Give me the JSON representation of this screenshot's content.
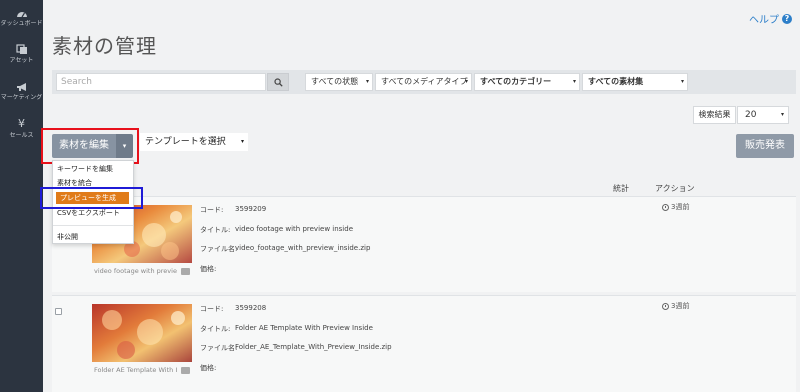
{
  "sidebar": {
    "items": [
      {
        "label": "ダッシュボード",
        "icon": "dashboard-icon"
      },
      {
        "label": "アセット",
        "icon": "assets-icon"
      },
      {
        "label": "マーケティング",
        "icon": "megaphone-icon"
      },
      {
        "label": "セールス",
        "icon": "yen-icon"
      }
    ],
    "yen_glyph": "¥"
  },
  "header": {
    "help_label": "ヘルプ",
    "help_glyph": "?",
    "title": "素材の管理"
  },
  "filters": {
    "search_placeholder": "Search",
    "status": "すべての状態",
    "media_type": "すべてのメディアタイプ",
    "category": "すべてのカテゴリー",
    "asset_set": "すべての素材集",
    "caret": "▾"
  },
  "results": {
    "label": "検索結果",
    "value": "20"
  },
  "toolbar": {
    "edit_label": "素材を編集",
    "template_label": "テンプレートを選択",
    "publish_label": "販売発表"
  },
  "dropdown": {
    "items": [
      "キーワードを編集",
      "素材を統合",
      "プレビューを生成",
      "CSVをエクスポート",
      "非公開"
    ],
    "active_index": 2
  },
  "columns": {
    "stats": "統計",
    "action": "アクション"
  },
  "rows": [
    {
      "caption": "video footage with previe",
      "code_label": "コード:",
      "code": "3599209",
      "title_label": "タイトル:",
      "title": "video footage with preview inside",
      "file_label": "ファイル名:",
      "file": "video_footage_with_preview_inside.zip",
      "price_label": "価格:",
      "time": "3週前"
    },
    {
      "caption": "Folder AE Template With I",
      "code_label": "コード:",
      "code": "3599208",
      "title_label": "タイトル:",
      "title": "Folder AE Template With Preview Inside",
      "file_label": "ファイル名:",
      "file": "Folder_AE_Template_With_Preview_Inside.zip",
      "price_label": "価格:",
      "time": "3週前"
    }
  ],
  "colors": {
    "sidebar": "#2c3440",
    "accent_orange": "#e07b19",
    "highlight_red": "#e8111b",
    "highlight_blue": "#1f1bd6",
    "link_blue": "#2d7fc9"
  }
}
